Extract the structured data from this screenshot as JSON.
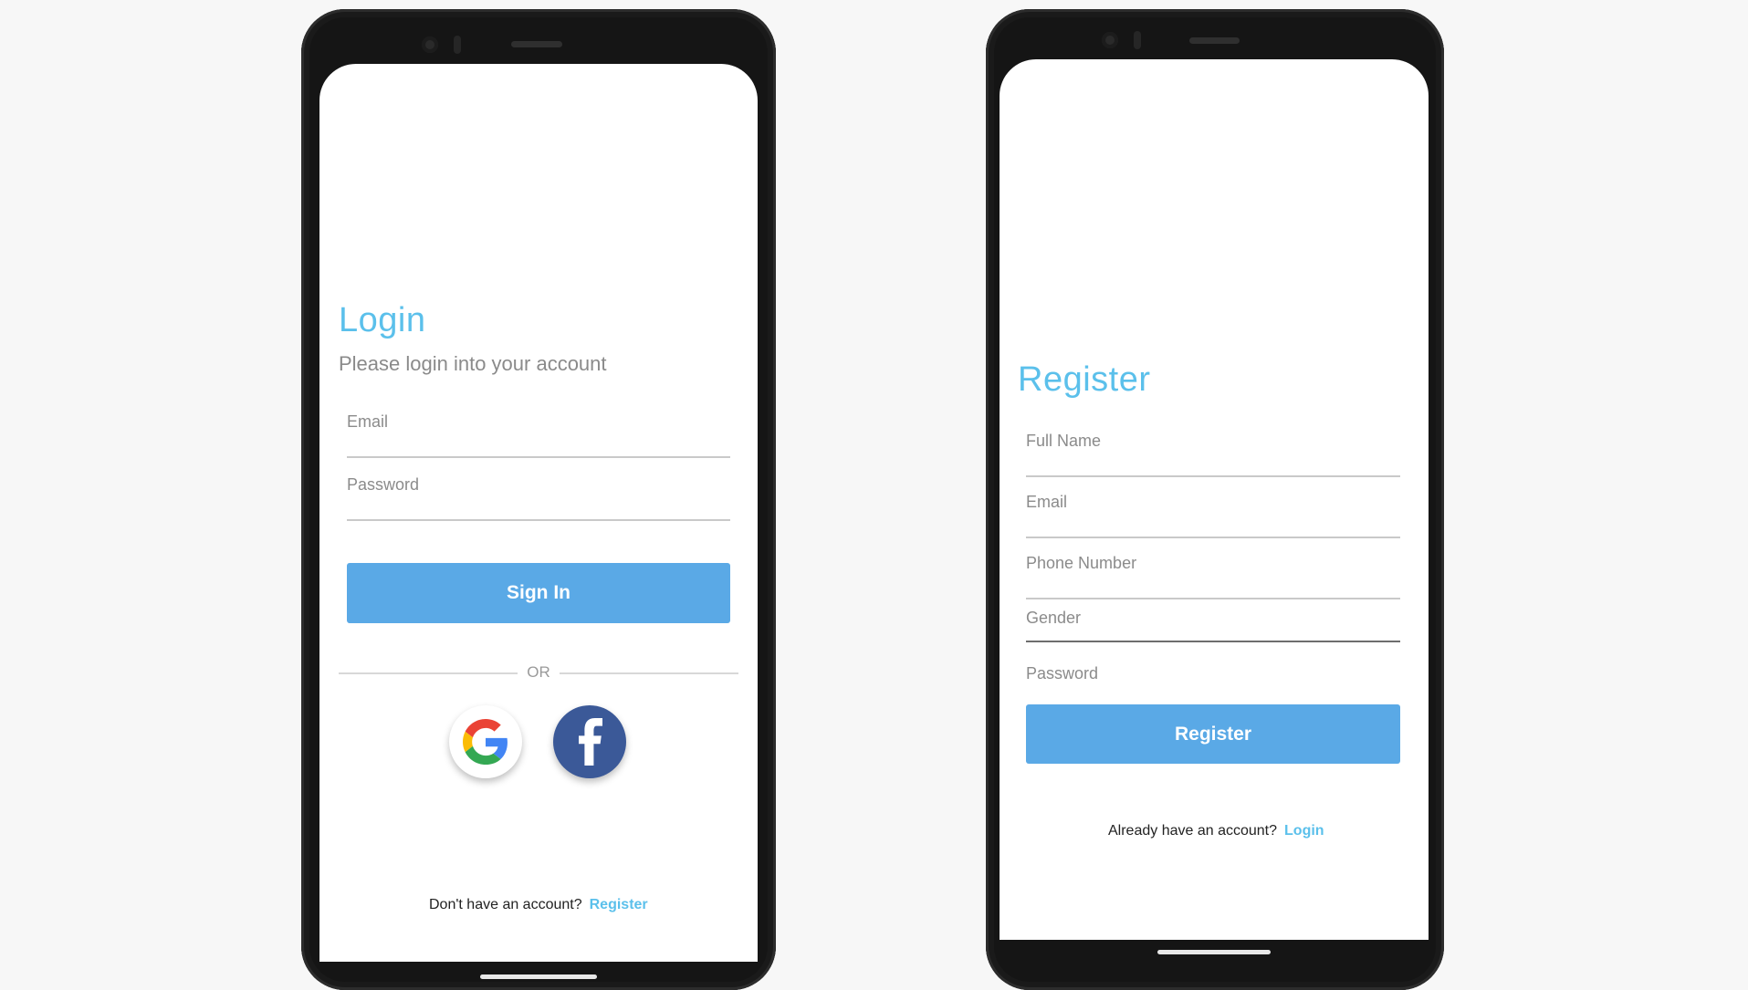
{
  "login": {
    "title": "Login",
    "subtitle": "Please login into your account",
    "email_label": "Email",
    "password_label": "Password",
    "sign_in_label": "Sign In",
    "divider_text": "OR",
    "social": [
      "google-icon",
      "facebook-icon"
    ],
    "footer_text": "Don't have an account?",
    "footer_link": "Register"
  },
  "register": {
    "title": "Register",
    "fields": [
      "Full Name",
      "Email",
      "Phone Number",
      "Gender",
      "Password"
    ],
    "register_label": "Register",
    "footer_text": "Already have an account?",
    "footer_link": "Login"
  },
  "colors": {
    "accent": "#5bc0eb",
    "button": "#5aa9e6",
    "facebook": "#3b5998"
  }
}
